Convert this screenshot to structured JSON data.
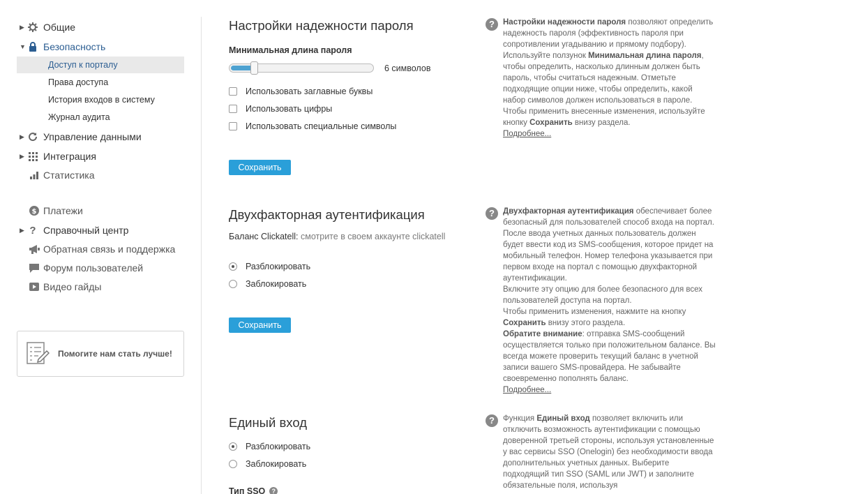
{
  "sidebar": {
    "general": "Общие",
    "security": "Безопасность",
    "security_items": [
      "Доступ к порталу",
      "Права доступа",
      "История входов в систему",
      "Журнал аудита"
    ],
    "data_management": "Управление данными",
    "integration": "Интеграция",
    "statistics": "Статистика",
    "payments": "Платежи",
    "help_center": "Справочный центр",
    "feedback": "Обратная связь и поддержка",
    "forum": "Форум пользователей",
    "video": "Видео гайды",
    "help_box": "Помогите нам стать лучше!"
  },
  "password": {
    "title": "Настройки надежности пароля",
    "min_length_label": "Минимальная длина пароля",
    "min_length_value": "6 символов",
    "slider_fraction": 0.15,
    "options": [
      "Использовать заглавные буквы",
      "Использовать цифры",
      "Использовать специальные символы"
    ],
    "save": "Сохранить"
  },
  "two_factor": {
    "title": "Двухфакторная аутентификация",
    "balance_label": "Баланс Clickatell:",
    "balance_link": "смотрите в своем аккаунте clickatell",
    "enable": "Разблокировать",
    "disable": "Заблокировать",
    "save": "Сохранить"
  },
  "sso": {
    "title": "Единый вход",
    "enable": "Разблокировать",
    "disable": "Заблокировать",
    "type_label": "Тип SSO"
  },
  "help_password": {
    "b1": "Настройки надежности пароля",
    "t1": " позволяют определить надежность пароля (эффективность пароля при сопротивлении угадыванию и прямому подбору).",
    "t2": "Используйте ползунок ",
    "b2": "Минимальная длина пароля",
    "t3": ", чтобы определить, насколько длинным должен быть пароль, чтобы считаться надежным. Отметьте подходящие опции ниже, чтобы определить, какой набор символов должен использоваться в пароле. Чтобы применить внесенные изменения, используйте кнопку ",
    "b3": "Сохранить",
    "t4": " внизу раздела.",
    "more": "Подробнее..."
  },
  "help_2fa": {
    "b1": "Двухфакторная аутентификация",
    "t1": " обеспечивает более безопасный для пользователей способ входа на портал. После ввода учетных данных пользователь должен будет ввести код из SMS-сообщения, которое придет на мобильный телефон. Номер телефона указывается при первом входе на портал с помощью двухфакторной аутентификации.",
    "t2": "Включите эту опцию для более безопасного для всех пользователей доступа на портал.",
    "t3": "Чтобы применить изменения, нажмите на кнопку ",
    "b2": "Сохранить",
    "t4": " внизу этого раздела.",
    "b3": "Обратите внимание",
    "t5": ": отправка SMS-сообщений осуществляется только при положительном балансе. Вы всегда можете проверить текущий баланс в учетной записи вашего SMS-провайдера. Не забывайте своевременно пополнять баланс.",
    "more": "Подробнее..."
  },
  "help_sso": {
    "t1": "Функция ",
    "b1": "Единый вход",
    "t2": " позволяет включить или отключить возможность аутентификации с помощью доверенной третьей стороны, используя установленные у вас сервисы SSO (Onelogin) без необходимости ввода дополнительных учетных данных. Выберите подходящий тип SSO (SAML или JWT) и заполните обязательные поля, используя"
  }
}
